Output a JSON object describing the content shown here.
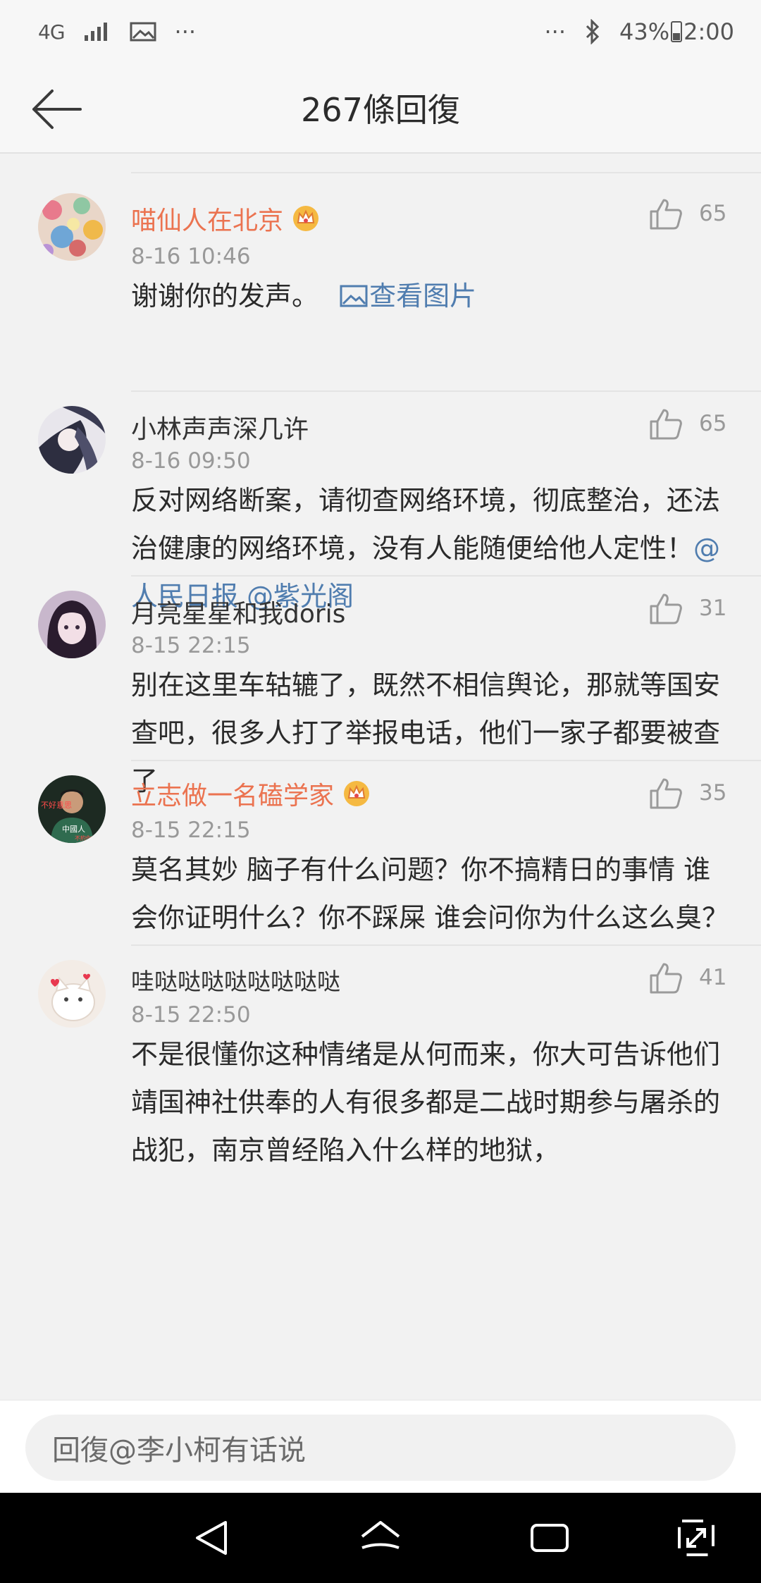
{
  "status_bar": {
    "network": "4G",
    "more_left": "···",
    "more_right": "···",
    "battery": "43%",
    "time": "2:00"
  },
  "header": {
    "title": "267條回復"
  },
  "comments": [
    {
      "name": "喵仙人在北京",
      "vip": true,
      "time": "8-16 10:46",
      "text": "谢谢你的发声。",
      "image_link": "查看图片",
      "likes": "65"
    },
    {
      "name": "小林声声深几许",
      "vip": false,
      "time": "8-16 09:50",
      "text": "反对网络断案，请彻查网络环境，彻底整治，还法治健康的网络环境，没有人能随便给他人定性！",
      "mentions": [
        "@人民日报",
        "@紫光阁"
      ],
      "likes": "65"
    },
    {
      "name": "月亮星星和我doris",
      "vip": false,
      "time": "8-15 22:15",
      "text": "别在这里车轱辘了，既然不相信舆论，那就等国安查吧，很多人打了举报电话，他们一家子都要被查了",
      "likes": "31"
    },
    {
      "name": "立志做一名磕学家",
      "vip": true,
      "time": "8-15 22:15",
      "text": "莫名其妙 脑子有什么问题？你不搞精日的事情 谁会你证明什么？你不踩屎 谁会问你为什么这么臭？",
      "avatar_text": [
        "不好意思",
        "中國人",
        "不約你啦"
      ],
      "likes": "35"
    },
    {
      "name": "哇哒哒哒哒哒哒哒哒",
      "vip": false,
      "time": "8-15 22:50",
      "text": "不是很懂你这种情绪是从何而来，你大可告诉他们靖国神社供奉的人有很多都是二战时期参与屠杀的战犯，南京曾经陷入什么样的地狱，",
      "likes": "41"
    }
  ],
  "reply": {
    "placeholder": "回復@李小柯有话说"
  },
  "colors": {
    "accent_link": "#507daf",
    "vip_name": "#eb7350",
    "background": "#f2f2f2"
  }
}
